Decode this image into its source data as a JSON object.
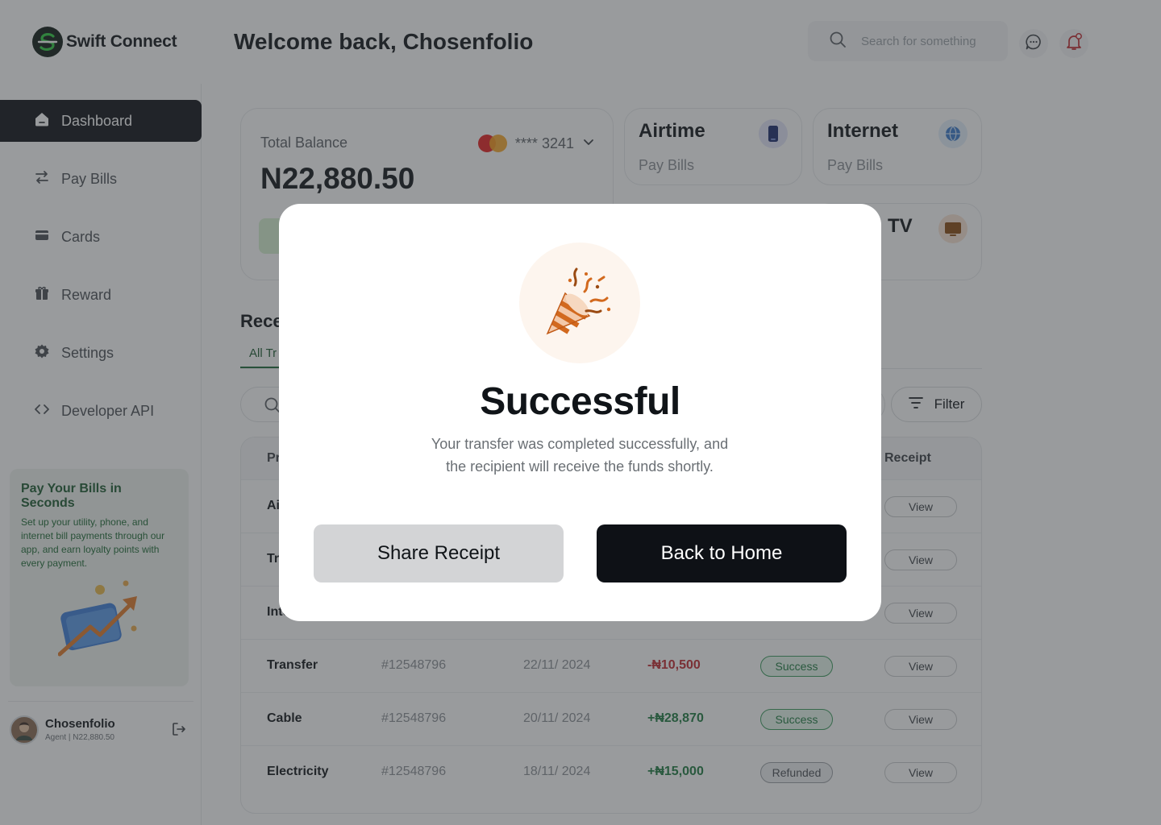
{
  "app": {
    "name": "Swift Connect"
  },
  "header": {
    "welcome": "Welcome back, Chosenfolio",
    "search_placeholder": "Search for something"
  },
  "sidebar": {
    "items": [
      {
        "label": "Dashboard",
        "icon": "home-icon",
        "active": true
      },
      {
        "label": "Pay Bills",
        "icon": "transfer-arrows-icon",
        "active": false
      },
      {
        "label": "Cards",
        "icon": "card-icon",
        "active": false
      },
      {
        "label": "Reward",
        "icon": "gift-icon",
        "active": false
      },
      {
        "label": "Settings",
        "icon": "gear-icon",
        "active": false
      },
      {
        "label": "Developer API",
        "icon": "code-icon",
        "active": false
      }
    ],
    "promo": {
      "title": "Pay Your Bills in Seconds",
      "text": "Set up your utility, phone, and internet bill payments through our app, and earn loyalty points with every payment."
    },
    "profile": {
      "name": "Chosenfolio",
      "sub": "Agent | N22,880.50"
    }
  },
  "balance": {
    "label": "Total Balance",
    "amount": "N22,880.50",
    "card_number": "**** 3241"
  },
  "services": [
    {
      "title": "Airtime",
      "sub": "Pay Bills"
    },
    {
      "title": "Internet",
      "sub": "Pay Bills"
    },
    {
      "title": "TV",
      "sub": ""
    }
  ],
  "transactions": {
    "title": "Rece",
    "tab": "All Tr",
    "filter_label": "Filter",
    "headers": {
      "product": "Pr",
      "receipt": "Receipt"
    },
    "rows": [
      {
        "name": "Ai",
        "id": "",
        "date": "",
        "amount": "",
        "status": "",
        "view": "View"
      },
      {
        "name": "Tr",
        "id": "",
        "date": "",
        "amount": "",
        "status": "",
        "view": "View"
      },
      {
        "name": "Inte",
        "id": "",
        "date": "",
        "amount": "",
        "status": "",
        "view": "View"
      },
      {
        "name": "Transfer",
        "id": "#12548796",
        "date": "22/11/ 2024",
        "amount": "-₦10,500",
        "status": "Success",
        "view": "View"
      },
      {
        "name": "Cable",
        "id": "#12548796",
        "date": "20/11/ 2024",
        "amount": "+₦28,870",
        "status": "Success",
        "view": "View"
      },
      {
        "name": "Electricity",
        "id": "#12548796",
        "date": "18/11/ 2024",
        "amount": "+₦15,000",
        "status": "Refunded",
        "view": "View"
      }
    ]
  },
  "modal": {
    "title": "Successful",
    "text_line1": "Your transfer was completed successfully, and",
    "text_line2": "the recipient will receive the funds shortly.",
    "share_label": "Share Receipt",
    "home_label": "Back to Home"
  },
  "colors": {
    "primary_dark": "#0e1116",
    "success_green": "#1e7a40",
    "debit_red": "#c0282e",
    "promo_green": "#1c5a30",
    "confetti_orange": "#d2691e"
  }
}
